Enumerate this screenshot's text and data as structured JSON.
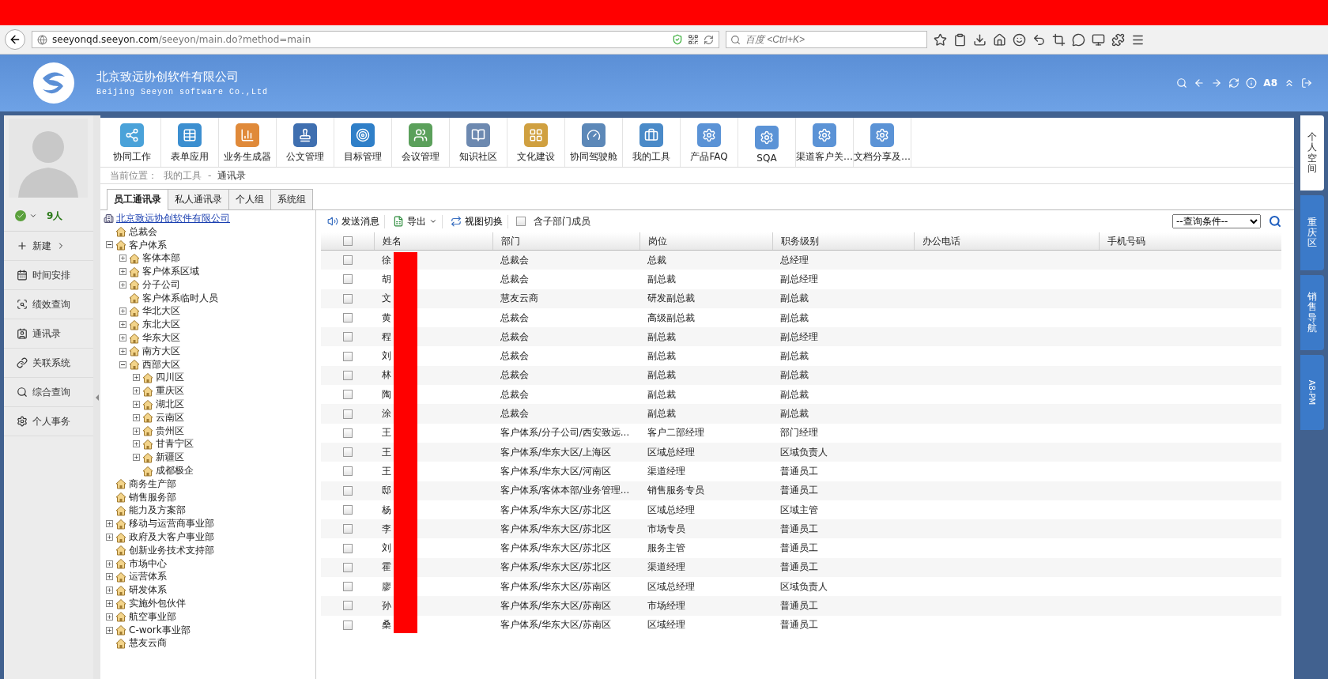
{
  "browser": {
    "url_host": "seeyonqd.seeyon.com",
    "url_path": "/seeyon/main.do?method=main",
    "search_placeholder": "百度 <Ctrl+K>"
  },
  "header": {
    "company": "北京致远协创软件有限公司",
    "company_en": "Beijing Seeyon software Co.,Ltd",
    "version_label": "A8"
  },
  "user": {
    "online_count": "9人"
  },
  "sidebar": {
    "items": [
      {
        "label": "新建",
        "has_submenu": true
      },
      {
        "label": "时间安排",
        "has_submenu": false
      },
      {
        "label": "绩效查询",
        "has_submenu": false
      },
      {
        "label": "通讯录",
        "has_submenu": false
      },
      {
        "label": "关联系统",
        "has_submenu": false
      },
      {
        "label": "综合查询",
        "has_submenu": false
      },
      {
        "label": "个人事务",
        "has_submenu": false
      }
    ]
  },
  "apps": [
    "协同工作",
    "表单应用",
    "业务生成器",
    "公文管理",
    "目标管理",
    "会议管理",
    "知识社区",
    "文化建设",
    "协同驾驶舱",
    "我的工具",
    "产品FAQ",
    "SQA",
    "渠道客户关…",
    "文档分享及…"
  ],
  "breadcrumb": {
    "label": "当前位置：",
    "path": "我的工具",
    "separator": "-",
    "current": "通讯录"
  },
  "tabs": [
    {
      "label": "员工通讯录",
      "selected": true
    },
    {
      "label": "私人通讯录",
      "selected": false
    },
    {
      "label": "个人组",
      "selected": false
    },
    {
      "label": "系统组",
      "selected": false
    }
  ],
  "tree": {
    "root": "北京致远协创软件有限公司",
    "children": [
      {
        "label": "总裁会",
        "kind": "leaf"
      },
      {
        "label": "客户体系",
        "kind": "branch",
        "expanded": true,
        "children": [
          {
            "label": "客体本部",
            "kind": "branch",
            "expanded": false
          },
          {
            "label": "客户体系区域",
            "kind": "branch",
            "expanded": false
          },
          {
            "label": "分子公司",
            "kind": "branch",
            "expanded": false
          },
          {
            "label": "客户体系临时人员",
            "kind": "leaf"
          },
          {
            "label": "华北大区",
            "kind": "branch",
            "expanded": false
          },
          {
            "label": "东北大区",
            "kind": "branch",
            "expanded": false
          },
          {
            "label": "华东大区",
            "kind": "branch",
            "expanded": false
          },
          {
            "label": "南方大区",
            "kind": "branch",
            "expanded": false
          },
          {
            "label": "西部大区",
            "kind": "branch",
            "expanded": true,
            "children": [
              {
                "label": "四川区",
                "kind": "branch",
                "expanded": false
              },
              {
                "label": "重庆区",
                "kind": "branch",
                "expanded": false
              },
              {
                "label": "湖北区",
                "kind": "branch",
                "expanded": false
              },
              {
                "label": "云南区",
                "kind": "branch",
                "expanded": false
              },
              {
                "label": "贵州区",
                "kind": "branch",
                "expanded": false
              },
              {
                "label": "甘青宁区",
                "kind": "branch",
                "expanded": false
              },
              {
                "label": "新疆区",
                "kind": "branch",
                "expanded": false
              },
              {
                "label": "成都极企",
                "kind": "leaf"
              }
            ]
          }
        ]
      },
      {
        "label": "商务生产部",
        "kind": "leaf"
      },
      {
        "label": "销售服务部",
        "kind": "leaf"
      },
      {
        "label": "能力及方案部",
        "kind": "leaf"
      },
      {
        "label": "移动与运营商事业部",
        "kind": "branch",
        "expanded": false
      },
      {
        "label": "政府及大客户事业部",
        "kind": "branch",
        "expanded": false
      },
      {
        "label": "创新业务技术支持部",
        "kind": "leaf"
      },
      {
        "label": "市场中心",
        "kind": "branch",
        "expanded": false
      },
      {
        "label": "运营体系",
        "kind": "branch",
        "expanded": false
      },
      {
        "label": "研发体系",
        "kind": "branch",
        "expanded": false
      },
      {
        "label": "实施外包伙伴",
        "kind": "branch",
        "expanded": false
      },
      {
        "label": "航空事业部",
        "kind": "branch",
        "expanded": false
      },
      {
        "label": "C-work事业部",
        "kind": "branch",
        "expanded": false
      },
      {
        "label": "慧友云商",
        "kind": "leaf"
      }
    ]
  },
  "actions": {
    "send": "发送消息",
    "export": "导出",
    "switch_view": "视图切换",
    "include_sub": {
      "label": "含子部门成员",
      "checked": false
    },
    "query_placeholder": "--查询条件--"
  },
  "table": {
    "redacted": true,
    "all_checked": false,
    "columns": [
      "姓名",
      "部门",
      "岗位",
      "职务级别",
      "办公电话",
      "手机号码"
    ],
    "rows": [
      {
        "checked": false,
        "cells": [
          "徐",
          "总裁会",
          "总裁",
          "总经理"
        ]
      },
      {
        "checked": false,
        "cells": [
          "胡",
          "总裁会",
          "副总裁",
          "副总经理"
        ]
      },
      {
        "checked": false,
        "cells": [
          "文",
          "慧友云商",
          "研发副总裁",
          "副总裁"
        ]
      },
      {
        "checked": false,
        "cells": [
          "黄",
          "总裁会",
          "高级副总裁",
          "副总裁"
        ]
      },
      {
        "checked": false,
        "cells": [
          "程",
          "总裁会",
          "副总裁",
          "副总经理"
        ]
      },
      {
        "checked": false,
        "cells": [
          "刘",
          "总裁会",
          "副总裁",
          "副总裁"
        ]
      },
      {
        "checked": false,
        "cells": [
          "林",
          "总裁会",
          "副总裁",
          "副总裁"
        ]
      },
      {
        "checked": false,
        "cells": [
          "陶",
          "总裁会",
          "副总裁",
          "副总裁"
        ]
      },
      {
        "checked": false,
        "cells": [
          "涂",
          "总裁会",
          "副总裁",
          "副总裁"
        ]
      },
      {
        "checked": false,
        "cells": [
          "王",
          "客户体系/分子公司/西安致远…",
          "客户二部经理",
          "部门经理"
        ]
      },
      {
        "checked": false,
        "cells": [
          "王",
          "客户体系/华东大区/上海区",
          "区域总经理",
          "区域负责人"
        ]
      },
      {
        "checked": false,
        "cells": [
          "王",
          "客户体系/华东大区/河南区",
          "渠道经理",
          "普通员工"
        ]
      },
      {
        "checked": false,
        "cells": [
          "邸",
          "客户体系/客体本部/业务管理…",
          "销售服务专员",
          "普通员工"
        ]
      },
      {
        "checked": false,
        "cells": [
          "杨",
          "客户体系/华东大区/苏北区",
          "区域总经理",
          "区域主管"
        ]
      },
      {
        "checked": false,
        "cells": [
          "李",
          "客户体系/华东大区/苏北区",
          "市场专员",
          "普通员工"
        ]
      },
      {
        "checked": false,
        "cells": [
          "刘",
          "客户体系/华东大区/苏北区",
          "服务主管",
          "普通员工"
        ]
      },
      {
        "checked": false,
        "cells": [
          "霍",
          "客户体系/华东大区/苏北区",
          "渠道经理",
          "普通员工"
        ]
      },
      {
        "checked": false,
        "cells": [
          "廖",
          "客户体系/华东大区/苏南区",
          "区域总经理",
          "区域负责人"
        ]
      },
      {
        "checked": false,
        "cells": [
          "孙",
          "客户体系/华东大区/苏南区",
          "市场经理",
          "普通员工"
        ]
      },
      {
        "checked": false,
        "cells": [
          "桑",
          "客户体系/华东大区/苏南区",
          "区域经理",
          "普通员工"
        ]
      }
    ]
  },
  "side_tabs": [
    {
      "label": "个人空间",
      "kind": "vertical",
      "selected": true
    },
    {
      "label": "重庆区",
      "kind": "vertical",
      "selected": false
    },
    {
      "label": "销售导航",
      "kind": "vertical",
      "selected": false
    },
    {
      "label": "A8-PM",
      "kind": "rotated",
      "selected": false
    }
  ]
}
